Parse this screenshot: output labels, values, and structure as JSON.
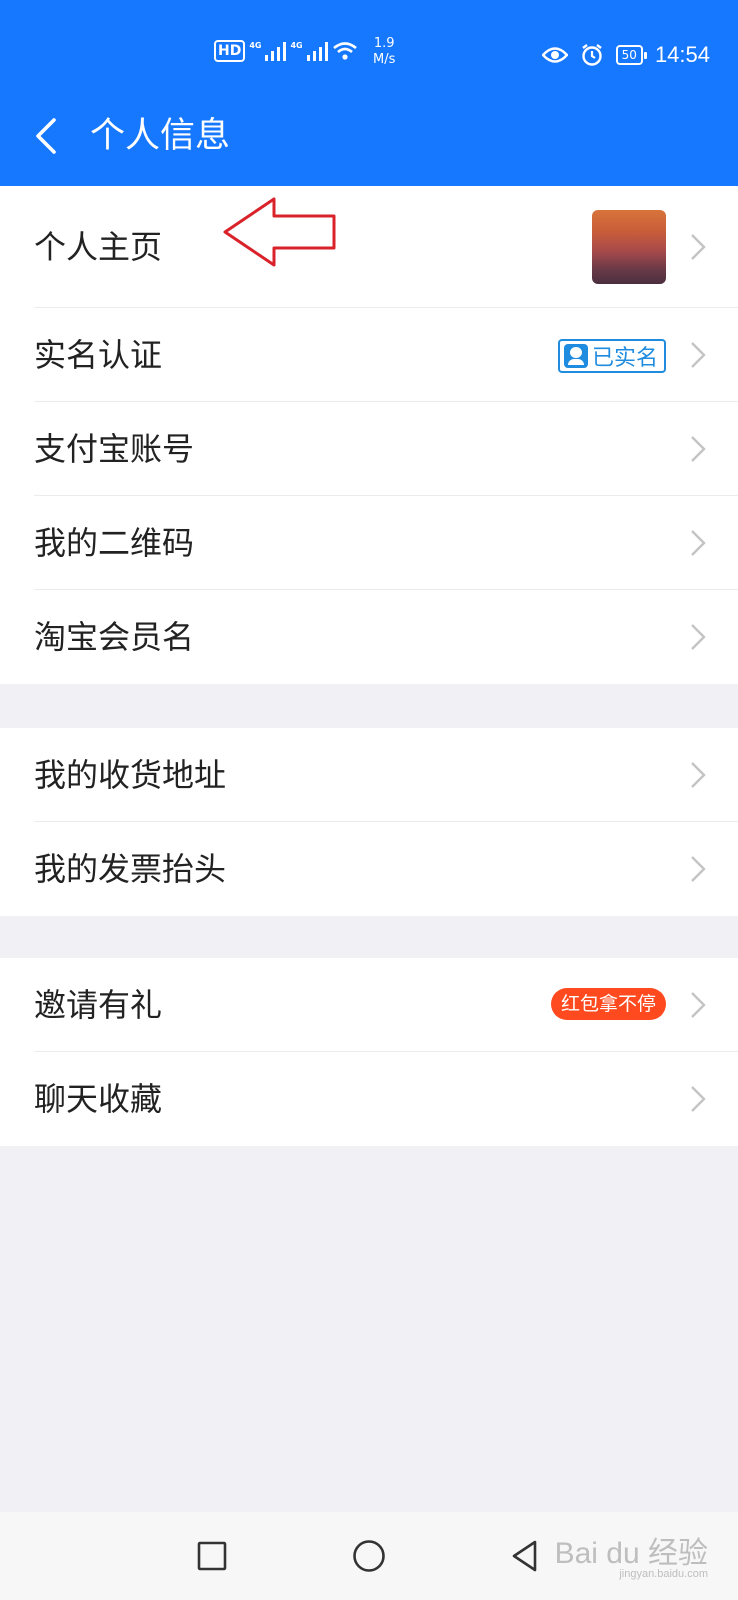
{
  "status_bar": {
    "hd": "HD",
    "net1": "4G",
    "net2": "4G",
    "speed_value": "1.9",
    "speed_unit": "M/s",
    "battery": "50",
    "time": "14:54"
  },
  "header": {
    "title": "个人信息"
  },
  "sections": [
    {
      "items": [
        {
          "label": "个人主页",
          "accessory": "avatar"
        },
        {
          "label": "实名认证",
          "accessory": "badge",
          "badge_text": "已实名"
        },
        {
          "label": "支付宝账号"
        },
        {
          "label": "我的二维码"
        },
        {
          "label": "淘宝会员名"
        }
      ]
    },
    {
      "items": [
        {
          "label": "我的收货地址"
        },
        {
          "label": "我的发票抬头"
        }
      ]
    },
    {
      "items": [
        {
          "label": "邀请有礼",
          "accessory": "promo",
          "promo_text": "红包拿不停"
        },
        {
          "label": "聊天收藏"
        }
      ]
    }
  ],
  "watermark": {
    "brand": "Bai du 经验",
    "url": "jingyan.baidu.com"
  },
  "colors": {
    "header_bg": "#1677ff",
    "verified": "#1f8ce0",
    "promo": "#ff4a1f",
    "annotation_arrow": "#d9222a"
  }
}
